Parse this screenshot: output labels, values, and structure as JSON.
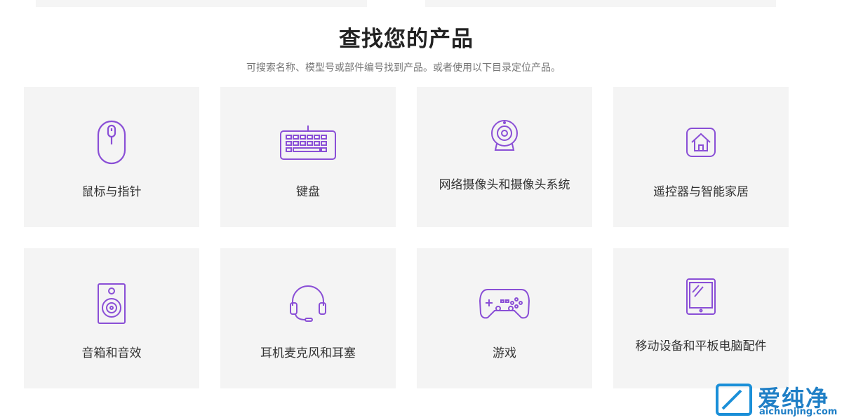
{
  "heading": "查找您的产品",
  "subheading": "可搜索名称、模型号或部件编号找到产品。或者使用以下目录定位产品。",
  "accent_color": "#8a4fd6",
  "categories": [
    {
      "label": "鼠标与指针",
      "icon": "mouse-icon"
    },
    {
      "label": "键盘",
      "icon": "keyboard-icon"
    },
    {
      "label": "网络摄像头和摄像头系统",
      "icon": "webcam-icon"
    },
    {
      "label": "遥控器与智能家居",
      "icon": "smart-home-icon"
    },
    {
      "label": "音箱和音效",
      "icon": "speaker-icon"
    },
    {
      "label": "耳机麦克风和耳塞",
      "icon": "headset-icon"
    },
    {
      "label": "游戏",
      "icon": "gamepad-icon"
    },
    {
      "label": "移动设备和平板电脑配件",
      "icon": "tablet-icon"
    }
  ],
  "watermark": {
    "text": "爱纯净",
    "url": "aichunjing.com"
  }
}
